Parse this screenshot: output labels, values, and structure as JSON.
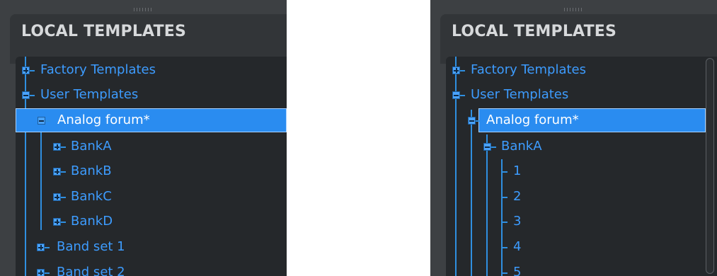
{
  "panels": [
    {
      "title": "LOCAL TEMPLATES",
      "items": [
        {
          "label": "Factory Templates",
          "expand": "+"
        },
        {
          "label": "User Templates",
          "expand": "−"
        },
        {
          "label": "Analog forum*",
          "expand": "−",
          "selected": true
        },
        {
          "label": "BankA",
          "expand": "+"
        },
        {
          "label": "BankB",
          "expand": "+"
        },
        {
          "label": "BankC",
          "expand": "+"
        },
        {
          "label": "BankD",
          "expand": "+"
        },
        {
          "label": "Band set 1",
          "expand": "+"
        },
        {
          "label": "Band set 2",
          "expand": "+"
        }
      ]
    },
    {
      "title": "LOCAL TEMPLATES",
      "items": [
        {
          "label": "Factory Templates",
          "expand": "+"
        },
        {
          "label": "User Templates",
          "expand": "−"
        },
        {
          "label": "Analog forum*",
          "expand": "−",
          "selected": true
        },
        {
          "label": "BankA",
          "expand": "−"
        },
        {
          "label": "1"
        },
        {
          "label": "2"
        },
        {
          "label": "3"
        },
        {
          "label": "4"
        },
        {
          "label": "5"
        }
      ]
    }
  ],
  "colors": {
    "panel_bg": "#3d4043",
    "tree_bg": "#25282b",
    "accent": "#2f8fe0",
    "selection": "#2a8cf0",
    "title_text": "#d7d9db"
  }
}
